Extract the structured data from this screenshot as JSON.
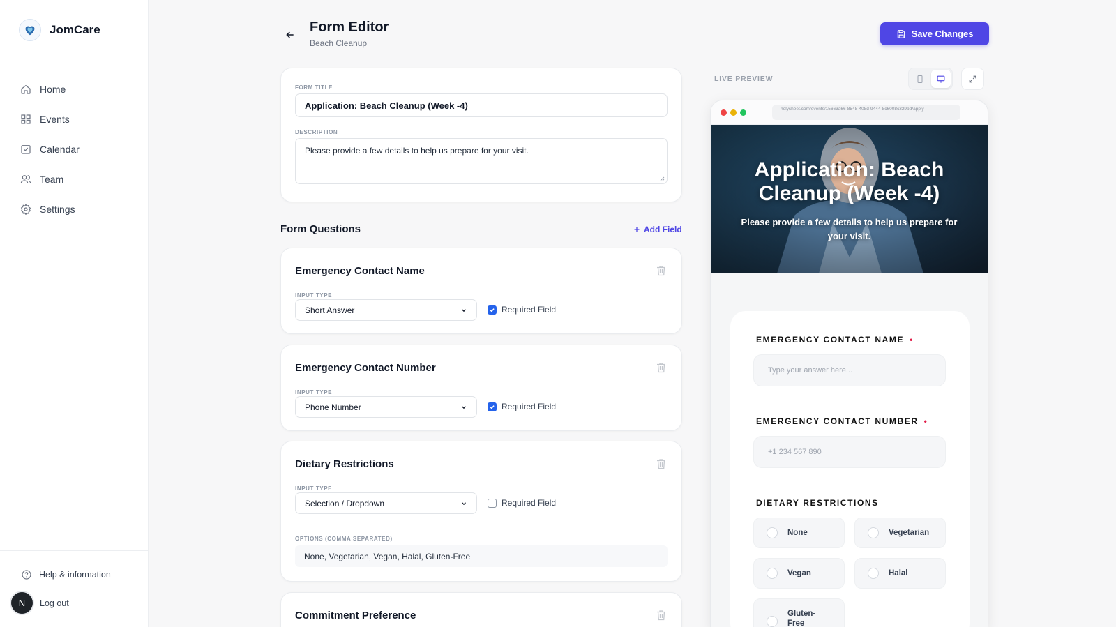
{
  "brand": {
    "name": "JomCare"
  },
  "nav": [
    {
      "label": "Home"
    },
    {
      "label": "Events"
    },
    {
      "label": "Calendar"
    },
    {
      "label": "Team"
    },
    {
      "label": "Settings"
    }
  ],
  "footer": {
    "help_label": "Help & information",
    "logout_label": "Log out",
    "avatar_initial": "N"
  },
  "header": {
    "title": "Form Editor",
    "subtitle": "Beach Cleanup",
    "save_label": "Save Changes"
  },
  "form": {
    "title_label": "FORM TITLE",
    "title_value": "Application: Beach Cleanup (Week -4)",
    "description_label": "DESCRIPTION",
    "description_value": "Please provide a few details to help us prepare for your visit."
  },
  "questions_section": {
    "title": "Form Questions",
    "add_label": "Add Field"
  },
  "questions": [
    {
      "title": "Emergency Contact Name",
      "input_type_label": "INPUT TYPE",
      "input_type": "Short Answer",
      "required_label": "Required Field",
      "required": true
    },
    {
      "title": "Emergency Contact Number",
      "input_type_label": "INPUT TYPE",
      "input_type": "Phone Number",
      "required_label": "Required Field",
      "required": true
    },
    {
      "title": "Dietary Restrictions",
      "input_type_label": "INPUT TYPE",
      "input_type": "Selection / Dropdown",
      "required_label": "Required Field",
      "required": false,
      "options_label": "OPTIONS (COMMA SEPARATED)",
      "options_value": "None, Vegetarian, Vegan, Halal, Gluten-Free"
    },
    {
      "title": "Commitment Preference"
    }
  ],
  "preview": {
    "label": "LIVE PREVIEW",
    "url": "holysheet.com/events/15663a66-8548-408d-9444-8c6008c329bd/apply",
    "hero_title": "Application: Beach Cleanup (Week -4)",
    "hero_desc": "Please provide a few details to help us prepare for your visit.",
    "fields": [
      {
        "label": "EMERGENCY CONTACT NAME",
        "required_mark": "•",
        "placeholder": "Type your answer here..."
      },
      {
        "label": "EMERGENCY CONTACT NUMBER",
        "required_mark": "•",
        "placeholder": "+1 234 567 890"
      },
      {
        "label": "DIETARY RESTRICTIONS",
        "options": [
          "None",
          "Vegetarian",
          "Vegan",
          "Halal",
          "Gluten-Free"
        ]
      }
    ]
  },
  "colors": {
    "accent": "#4f46e5",
    "checkbox": "#2563eb",
    "required": "#e11d48"
  }
}
